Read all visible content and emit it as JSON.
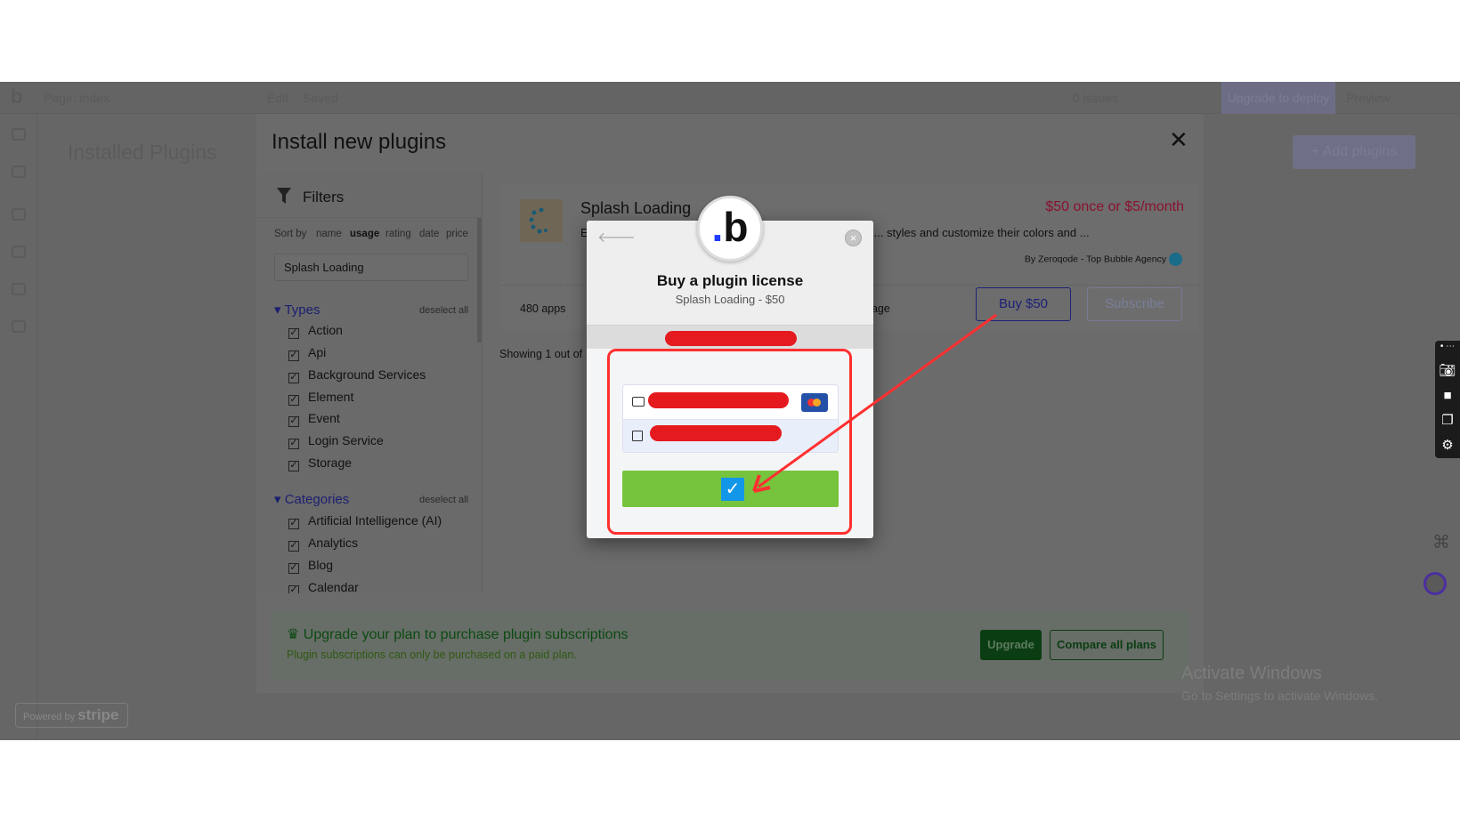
{
  "topbar": {
    "logo": "b",
    "page": "Page: index",
    "edit": "Edit",
    "saved": "Saved",
    "issues": "0 issues",
    "upgrade_deploy": "Upgrade to deploy",
    "preview": "Preview"
  },
  "background": {
    "installed_title": "Installed Plugins",
    "add_plugins": "+ Add plugins"
  },
  "panel": {
    "title": "Install new plugins",
    "close": "✕",
    "filters": {
      "title": "Filters",
      "sort_label": "Sort by",
      "sort_options": [
        "name",
        "usage",
        "rating",
        "date",
        "price"
      ],
      "sort_selected": "usage",
      "search_value": "Splash Loading",
      "types": {
        "label": "Types",
        "deselect": "deselect all",
        "items": [
          "Action",
          "Api",
          "Background Services",
          "Element",
          "Event",
          "Login Service",
          "Storage"
        ]
      },
      "categories": {
        "label": "Categories",
        "deselect": "deselect all",
        "items": [
          "Artificial Intelligence (AI)",
          "Analytics",
          "Blog",
          "Calendar"
        ]
      }
    },
    "plugin": {
      "name": "Splash Loading",
      "price": "$50 once or $5/month",
      "description": "E... ng Plugin, an intuitive and visually appealing way to c... styles and customize their colors and ...",
      "author": "By Zeroqode - Top Bubble Agency",
      "apps": "480 apps",
      "page_link": "page",
      "buy": "Buy $50",
      "subscribe": "Subscribe"
    },
    "showing": "Showing 1 out of",
    "banner": {
      "title": "Upgrade your plan to purchase plugin subscriptions",
      "subtitle": "Plugin subscriptions can only be purchased on a paid plan.",
      "upgrade": "Upgrade",
      "compare": "Compare all plans"
    }
  },
  "stripe": {
    "powered": "Powered by",
    "brand": "stripe"
  },
  "windows": {
    "line1": "Activate Windows",
    "line2": "Go to Settings to activate Windows."
  },
  "modal": {
    "title": "Buy a plugin license",
    "subtitle": "Splash Loading - $50",
    "back": "🡐",
    "close": "×"
  },
  "colors": {
    "accent_green": "#76c43d",
    "annotation_red": "#ff3030",
    "price_red": "#8a1130",
    "link_blue": "#1d2176"
  }
}
